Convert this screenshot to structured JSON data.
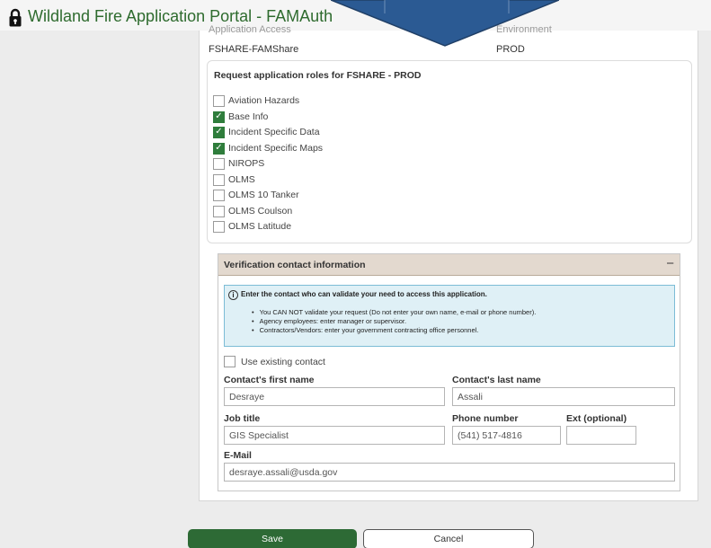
{
  "header": {
    "title": "Wildland Fire Application Portal - FAMAuth"
  },
  "application": {
    "cut_label_left": "Application Access",
    "cut_label_right": "Environment",
    "name": "FSHARE-FAMShare",
    "environment": "PROD"
  },
  "roles": {
    "title": "Request application roles for FSHARE - PROD",
    "items": [
      {
        "label": "Aviation Hazards",
        "checked": false
      },
      {
        "label": "Base Info",
        "checked": true
      },
      {
        "label": "Incident Specific Data",
        "checked": true
      },
      {
        "label": "Incident Specific Maps",
        "checked": true
      },
      {
        "label": "NIROPS",
        "checked": false
      },
      {
        "label": "OLMS",
        "checked": false
      },
      {
        "label": "OLMS 10 Tanker",
        "checked": false
      },
      {
        "label": "OLMS Coulson",
        "checked": false
      },
      {
        "label": "OLMS Latitude",
        "checked": false
      }
    ]
  },
  "verification": {
    "title": "Verification contact information",
    "collapse_symbol": "−",
    "info_title": "Enter the contact who can validate your need to access this application.",
    "info_items": [
      "You CAN NOT validate your request (Do not enter your own name, e-mail or phone number).",
      "Agency employees: enter manager or supervisor.",
      "Contractors/Vendors: enter your government contracting office personnel."
    ],
    "use_existing_label": "Use existing contact",
    "first_name_label": "Contact's first name",
    "first_name_value": "Desraye",
    "last_name_label": "Contact's last name",
    "last_name_value": "Assali",
    "job_title_label": "Job title",
    "job_title_value": "GIS Specialist",
    "phone_label": "Phone number",
    "phone_value": "(541) 517-4816",
    "ext_label": "Ext (optional)",
    "ext_value": "",
    "email_label": "E-Mail",
    "email_value": "desraye.assali@usda.gov"
  },
  "actions": {
    "save_label": "Save",
    "cancel_label": "Cancel"
  },
  "colors": {
    "brand_green": "#2e6b2e",
    "save_green": "#2d6a35",
    "arrow_blue": "#2b5a93"
  },
  "icons": {
    "lock": "lock-icon",
    "info": "info-icon",
    "arrow": "down-arrow-annotation-icon"
  }
}
